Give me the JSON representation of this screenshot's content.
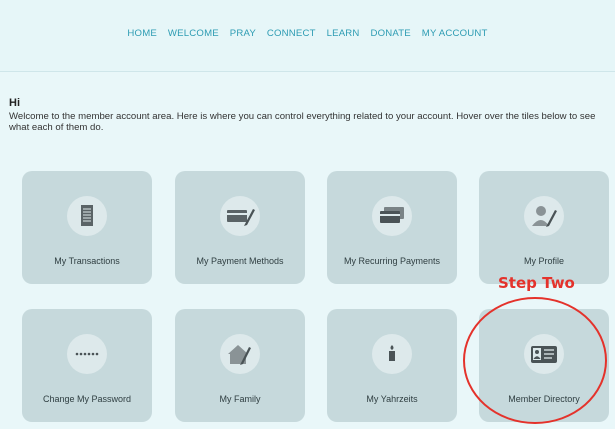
{
  "nav": {
    "items": [
      "HOME",
      "WELCOME",
      "PRAY",
      "CONNECT",
      "LEARN",
      "DONATE",
      "MY ACCOUNT"
    ]
  },
  "page": {
    "greeting": "Hi",
    "welcome": "Welcome to the member account area. Here is where you can control everything related to your account. Hover over the tiles below to see what each of them do."
  },
  "tiles": [
    {
      "label": "My Transactions",
      "icon": "document-icon"
    },
    {
      "label": "My Payment Methods",
      "icon": "card-pen-icon"
    },
    {
      "label": "My Recurring Payments",
      "icon": "cards-icon"
    },
    {
      "label": "My Profile",
      "icon": "user-pen-icon"
    },
    {
      "label": "Change My Password",
      "icon": "password-dots-icon"
    },
    {
      "label": "My Family",
      "icon": "house-pen-icon"
    },
    {
      "label": "My Yahrzeits",
      "icon": "candle-icon"
    },
    {
      "label": "Member Directory",
      "icon": "id-card-icon"
    }
  ],
  "annotation": {
    "text": "Step Two",
    "color": "#e4322b"
  },
  "colors": {
    "nav_link": "#2e9cb3",
    "tile_bg": "#c6d9dc",
    "page_bg": "#e9f7f9"
  }
}
